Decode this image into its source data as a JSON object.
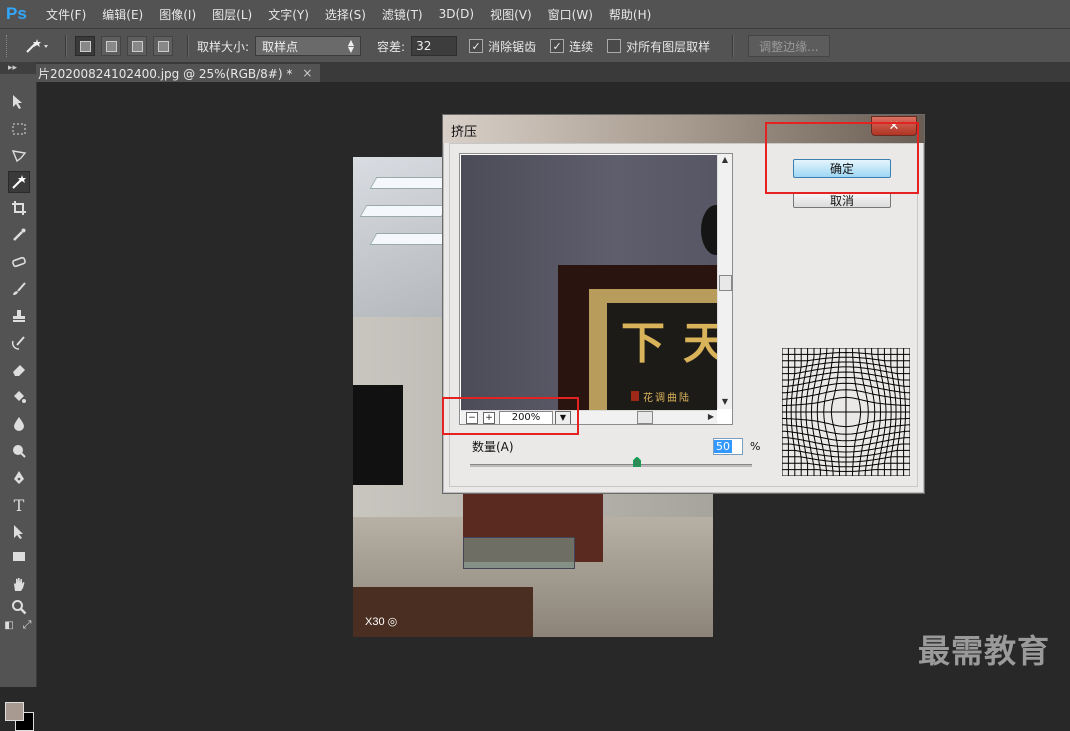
{
  "app": {
    "logo": "Ps"
  },
  "menu": [
    "文件(F)",
    "编辑(E)",
    "图像(I)",
    "图层(L)",
    "文字(Y)",
    "选择(S)",
    "滤镜(T)",
    "3D(D)",
    "视图(V)",
    "窗口(W)",
    "帮助(H)"
  ],
  "options": {
    "tool_icon": "magic-wand-icon",
    "sample_size_label": "取样大小:",
    "sample_size_value": "取样点",
    "tolerance_label": "容差:",
    "tolerance_value": "32",
    "antialias_label": "消除锯齿",
    "antialias_checked": true,
    "contiguous_label": "连续",
    "contiguous_checked": true,
    "sample_all_layers_label": "对所有图层取样",
    "sample_all_layers_checked": false,
    "refine_edge_label": "调整边缘..."
  },
  "document": {
    "tab_title": "片20200824102400.jpg @ 25%(RGB/8#) *",
    "close_glyph": "×",
    "photo_watermark": "X30 ◎"
  },
  "dialog": {
    "title": "挤压",
    "close_glyph": "✕",
    "ok_label": "确定",
    "cancel_label": "取消",
    "zoom_minus": "−",
    "zoom_plus": "+",
    "zoom_value": "200%",
    "amount_label": "数量(A)",
    "amount_value": "50",
    "amount_unit": "%",
    "amount_level_percent": 50,
    "preview_chars": [
      "下",
      "天"
    ],
    "preview_small_text": "花调曲陆"
  },
  "colors": {
    "foreground": "#a89a90",
    "background": "#000000",
    "highlight": "#e52222"
  },
  "watermark": "最需教育"
}
